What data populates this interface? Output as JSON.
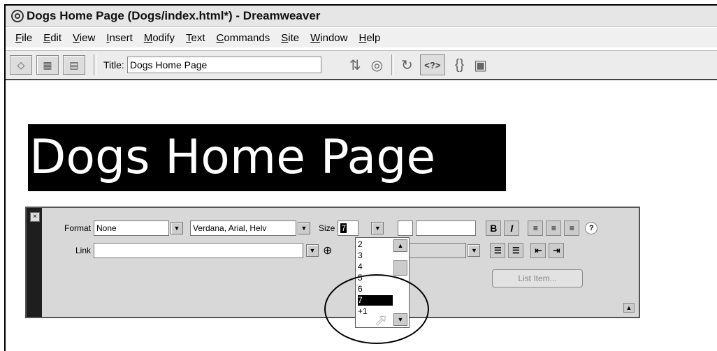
{
  "window": {
    "title": "Dogs Home Page (Dogs/index.html*) - Dreamweaver"
  },
  "menu": [
    "File",
    "Edit",
    "View",
    "Insert",
    "Modify",
    "Text",
    "Commands",
    "Site",
    "Window",
    "Help"
  ],
  "menu_underline": [
    "F",
    "E",
    "V",
    "I",
    "M",
    "T",
    "C",
    "S",
    "W",
    "H"
  ],
  "menu_rest": [
    "ile",
    "dit",
    "iew",
    "nsert",
    "odify",
    "ext",
    "ommands",
    "ite",
    "indow",
    "elp"
  ],
  "toolbar": {
    "title_label": "Title:",
    "title_value": "Dogs Home Page",
    "tag_button": "<?>",
    "braces": "{}"
  },
  "page": {
    "heading": "Dogs Home Page"
  },
  "properties": {
    "format_label": "Format",
    "format_value": "None",
    "font_value": "Verdana, Arial, Helv",
    "size_label": "Size",
    "size_value": "7",
    "link_label": "Link",
    "link_value": "",
    "bold": "B",
    "italic": "I",
    "help_icon": "?",
    "list_item_button": "List Item..."
  },
  "size_options": [
    "2",
    "3",
    "4",
    "5",
    "6",
    "7",
    "+1"
  ],
  "selected_size": "7"
}
